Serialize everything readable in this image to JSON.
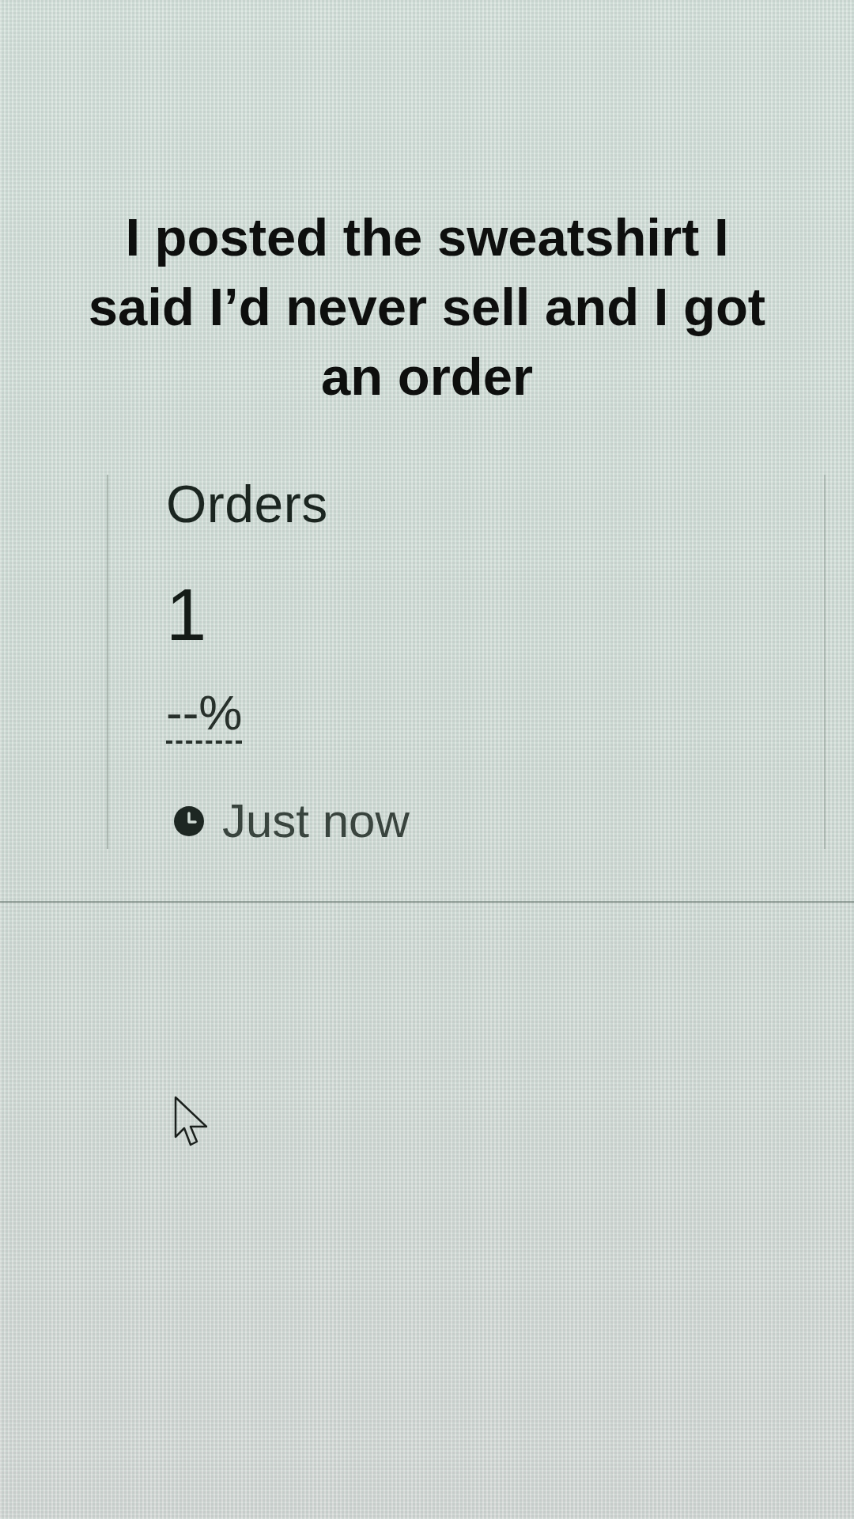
{
  "caption": "I posted the sweatshirt I said I’d never sell and I got an order",
  "stat_card": {
    "title": "Orders",
    "value": "1",
    "change": "--%",
    "updated": "Just now"
  }
}
